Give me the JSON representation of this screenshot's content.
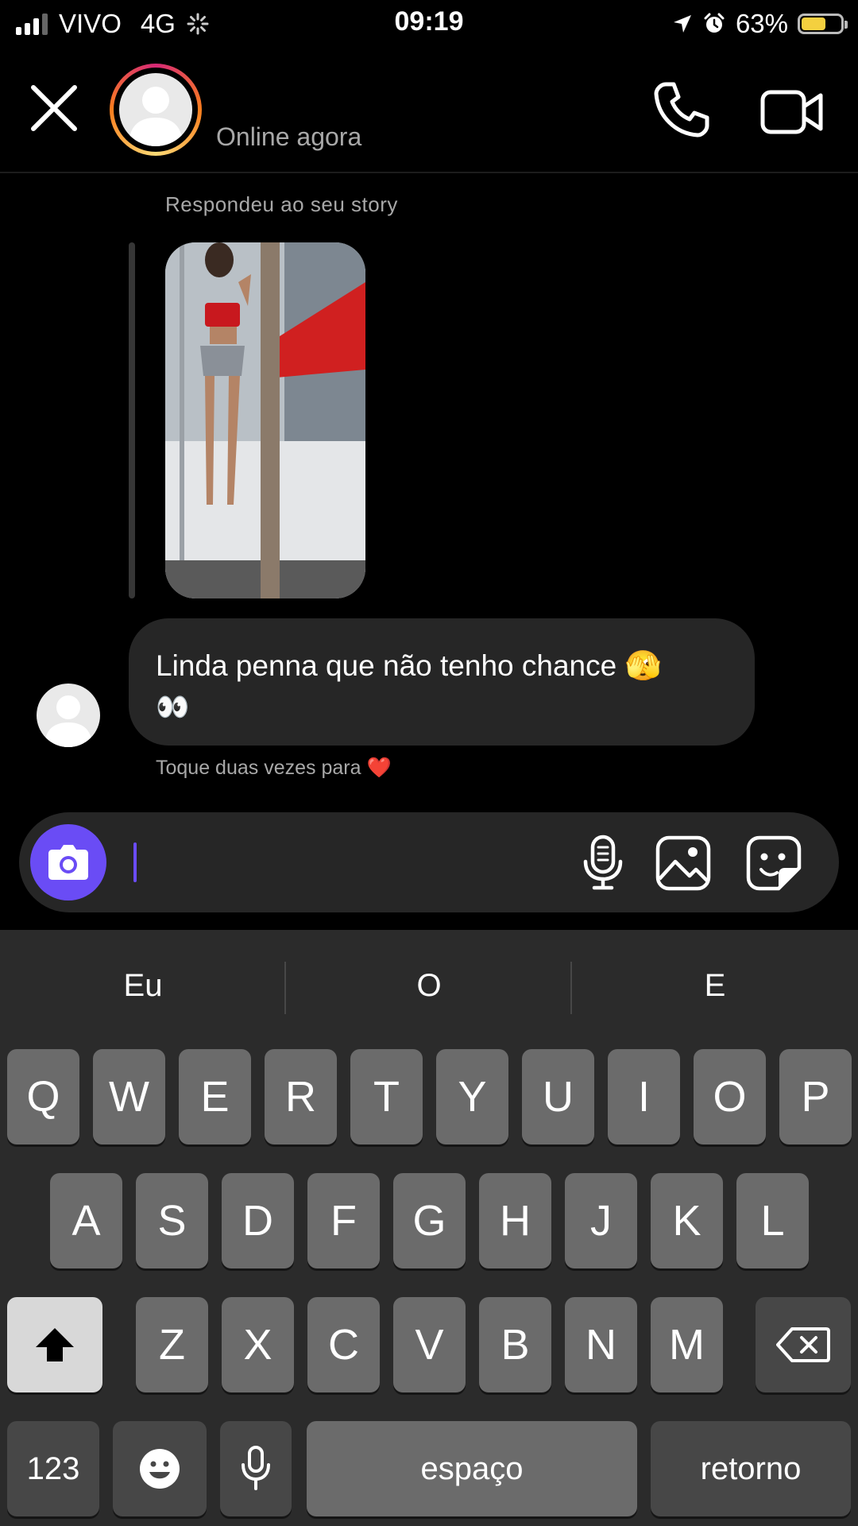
{
  "status_bar": {
    "carrier": "VIVO",
    "network": "4G",
    "time": "09:19",
    "battery_percent": "63%",
    "battery_level": 0.63,
    "icons": [
      "signal-icon",
      "loading-icon",
      "location-icon",
      "alarm-icon",
      "battery-icon"
    ]
  },
  "header": {
    "status_text": "Online agora",
    "icons": [
      "close-icon",
      "avatar",
      "phone-icon",
      "video-camera-icon"
    ]
  },
  "chat": {
    "replied_label": "Respondeu ao seu story",
    "message_line1": "Linda penna que não tenho chance 🫣",
    "message_line2": "👀",
    "double_tap_hint": "Toque duas vezes para ❤️"
  },
  "composer": {
    "icons": [
      "camera-icon",
      "microphone-icon",
      "gallery-icon",
      "sticker-icon"
    ],
    "accent": "#6a4cf5"
  },
  "keyboard": {
    "suggestions": [
      "Eu",
      "O",
      "E"
    ],
    "row1": [
      "Q",
      "W",
      "E",
      "R",
      "T",
      "Y",
      "U",
      "I",
      "O",
      "P"
    ],
    "row2": [
      "A",
      "S",
      "D",
      "F",
      "G",
      "H",
      "J",
      "K",
      "L"
    ],
    "row3": [
      "Z",
      "X",
      "C",
      "V",
      "B",
      "N",
      "M"
    ],
    "numbers_key": "123",
    "space_key": "espaço",
    "return_key": "retorno"
  }
}
